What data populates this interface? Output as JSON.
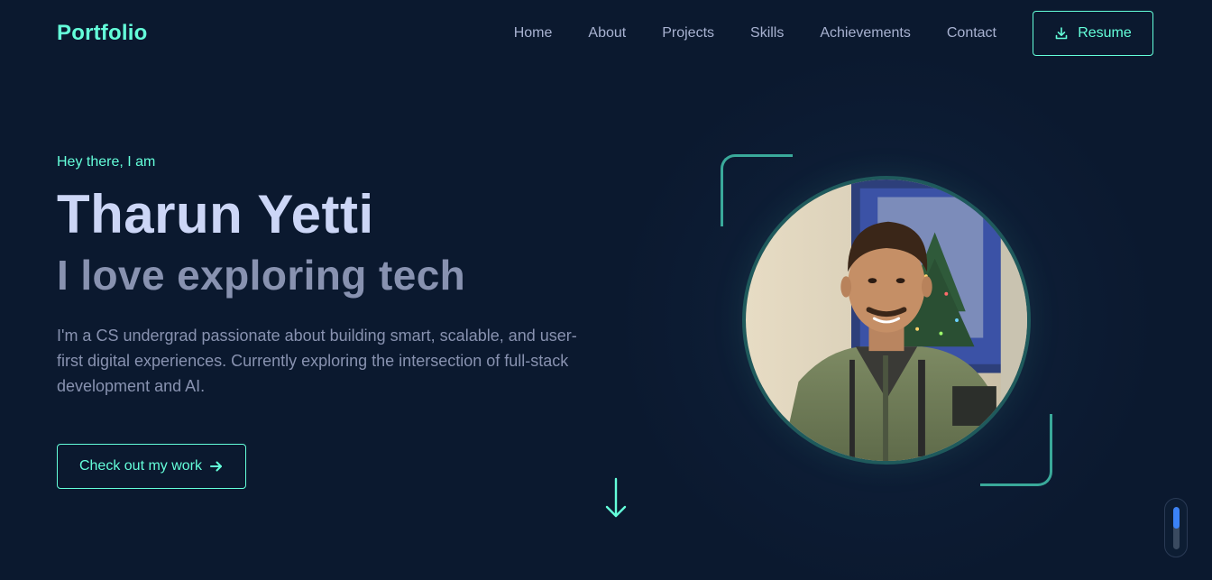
{
  "header": {
    "logo": "Portfolio",
    "nav": [
      "Home",
      "About",
      "Projects",
      "Skills",
      "Achievements",
      "Contact"
    ],
    "resume_label": "Resume",
    "resume_icon": "download-icon"
  },
  "hero": {
    "greeting": "Hey there, I am",
    "name": "Tharun Yetti",
    "tagline": "I love exploring tech",
    "bio": "I'm a CS undergrad passionate about building smart, scalable, and user-first digital experiences. Currently exploring the intersection of full-stack development and AI.",
    "cta_label": "Check out my work",
    "cta_icon": "arrow-right-icon"
  },
  "scroll_arrow_icon": "arrow-down-icon",
  "scroll_progress": 0.5,
  "colors": {
    "background": "#0b192f",
    "accent": "#64ffda",
    "heading": "#ccd6f6",
    "muted": "#8892b0",
    "scroll_fill": "#3b82f6"
  }
}
